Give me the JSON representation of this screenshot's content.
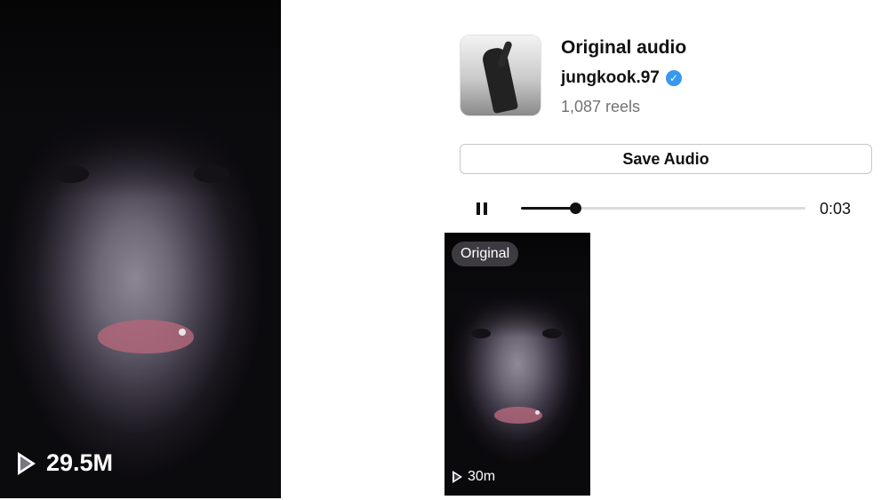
{
  "reel_large": {
    "views": "29.5M",
    "play_icon": "play-outline-icon"
  },
  "audio": {
    "title": "Original audio",
    "artist": "jungkook.97",
    "verified": true,
    "reel_count": "1,087 reels",
    "save_label": "Save Audio"
  },
  "player": {
    "state": "playing",
    "pause_icon": "pause-icon",
    "progress": 0.19,
    "time": "0:03"
  },
  "reel_small": {
    "badge": "Original",
    "views": "30m",
    "play_icon": "play-outline-icon"
  },
  "colors": {
    "verified_badge": "#3897f0",
    "muted_text": "#737373"
  }
}
